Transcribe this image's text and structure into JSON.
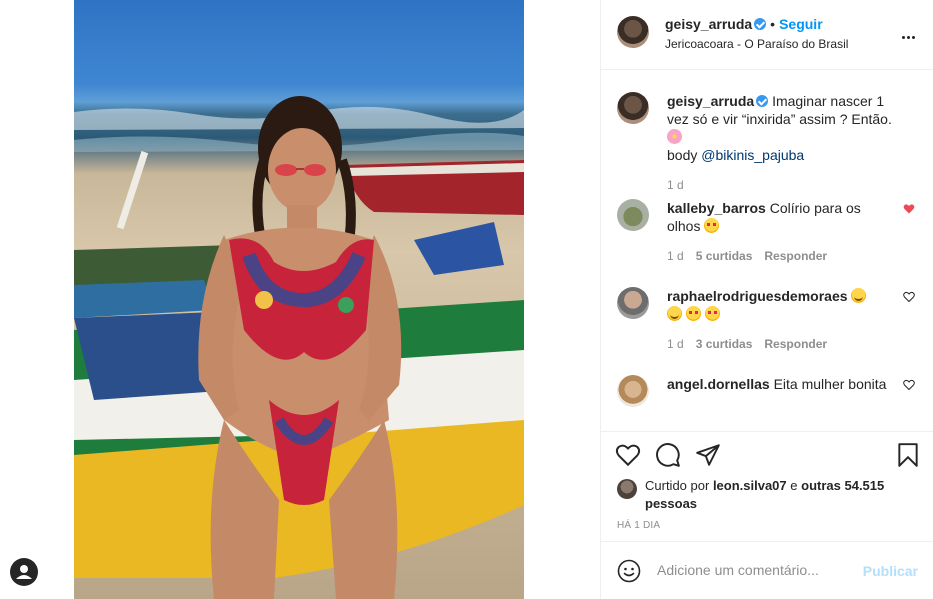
{
  "post": {
    "username": "geisy_arruda",
    "follow_label": "Seguir",
    "dot": "•",
    "location": "Jericoacoara - O Paraíso do Brasil",
    "caption_prefix": "Imaginar nascer 1 vez só e vir “inxirida” assim ? Então.",
    "caption_body": "body",
    "caption_mention": "@bikinis_pajuba",
    "caption_time": "1 d"
  },
  "comments": [
    {
      "username": "kalleby_barros",
      "text": "Colírio para os olhos",
      "time": "1 d",
      "likes": "5 curtidas",
      "reply": "Responder",
      "liked": true
    },
    {
      "username": "raphaelrodriguesdemoraes",
      "text": "",
      "time": "1 d",
      "likes": "3 curtidas",
      "reply": "Responder",
      "liked": false
    },
    {
      "username": "angel.dornellas",
      "text": "Eita mulher bonita",
      "liked": false
    }
  ],
  "likes": {
    "prefix": "Curtido por",
    "user": "leon.silva07",
    "conj": "e",
    "others": "outras 54.515 pessoas"
  },
  "date": "HÁ 1 DIA",
  "add_comment": {
    "placeholder": "Adicione um comentário...",
    "publish_label": "Publicar"
  },
  "colors": {
    "accent": "#0095f6",
    "liked_heart": "#ed4956",
    "publish_disabled": "#b2dffc"
  },
  "icons": [
    "verified-icon",
    "more-options-icon",
    "heart-icon",
    "comment-icon",
    "share-icon",
    "save-icon",
    "emoji-icon",
    "user-icon"
  ]
}
